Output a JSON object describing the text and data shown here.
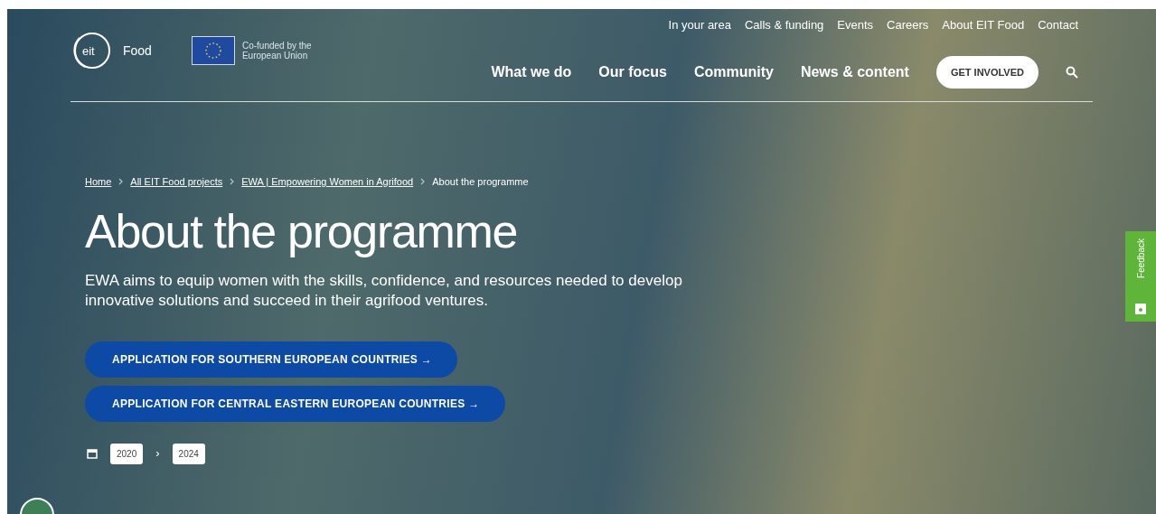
{
  "header": {
    "logo_mark": "eit",
    "logo_text": "Food",
    "eu_text": "Co-funded by the European Union",
    "utility_links": [
      "In your area",
      "Calls & funding",
      "Events",
      "Careers",
      "About EIT Food",
      "Contact"
    ],
    "main_nav": [
      "What we do",
      "Our focus",
      "Community",
      "News & content"
    ],
    "cta": "GET INVOLVED"
  },
  "breadcrumbs": [
    {
      "label": "Home",
      "current": false
    },
    {
      "label": "All EIT Food projects",
      "current": false
    },
    {
      "label": "EWA | Empowering Women in Agrifood",
      "current": false
    },
    {
      "label": "About the programme",
      "current": true
    }
  ],
  "title": "About the programme",
  "description": "EWA aims to equip women with the skills, confidence, and resources needed to develop innovative solutions and succeed in their agrifood ventures.",
  "buttons": [
    "APPLICATION FOR SOUTHERN EUROPEAN COUNTRIES →",
    "APPLICATION FOR CENTRAL EASTERN EUROPEAN COUNTRIES →"
  ],
  "dates": {
    "start": "2020",
    "separator": "›",
    "end": "2024"
  },
  "feedback": "Feedback"
}
